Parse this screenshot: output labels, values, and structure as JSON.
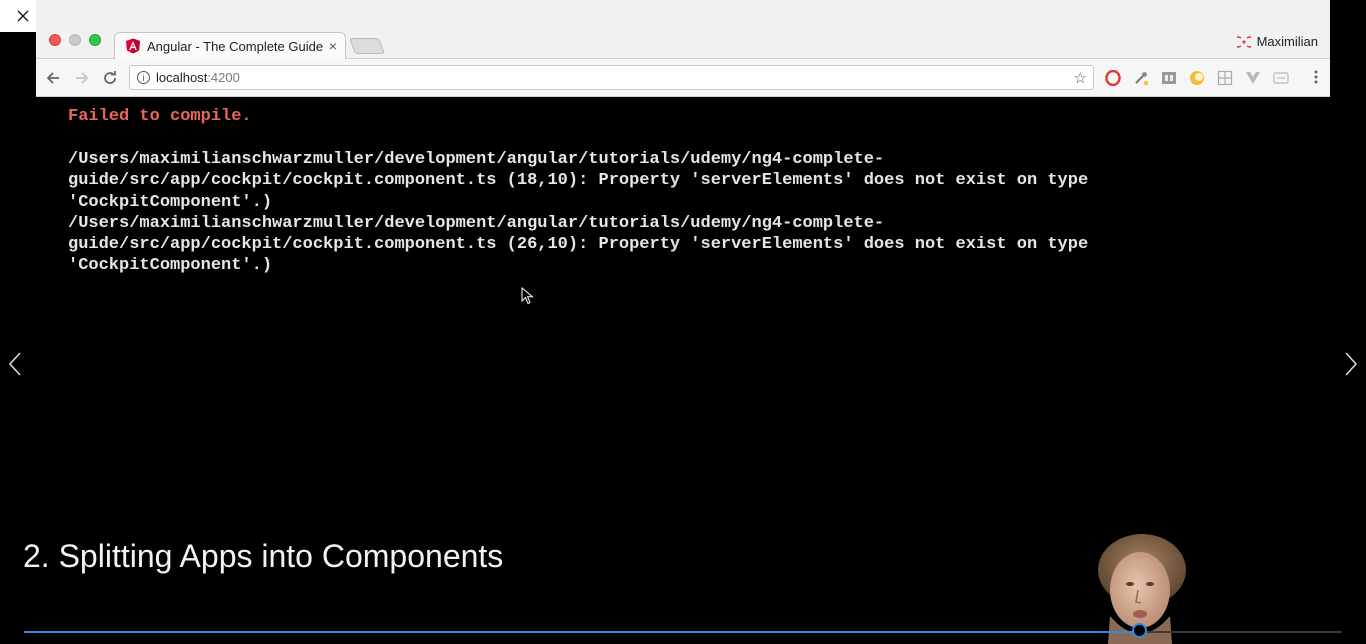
{
  "window_controls": {
    "close_icon": "close-icon",
    "restore_icon": "restore-icon",
    "minimize_icon": "minimize-icon"
  },
  "browser": {
    "tab": {
      "title": "Angular - The Complete Guide",
      "favicon": "angular-icon",
      "close": "×"
    },
    "profile": {
      "name": "Maximilian"
    },
    "address": {
      "host": "localhost",
      "port": ":4200"
    },
    "extensions": [
      "opera-icon",
      "eyedropper-icon",
      "jsonview-icon",
      "darkreader-icon",
      "grid-icon",
      "vue-icon",
      "cast-icon"
    ]
  },
  "page": {
    "error_title": "Failed to compile.",
    "error_lines": [
      "/Users/maximilianschwarzmuller/development/angular/tutorials/udemy/ng4-complete-",
      "guide/src/app/cockpit/cockpit.component.ts (18,10): Property 'serverElements' does not exist on type",
      "'CockpitComponent'.)",
      "/Users/maximilianschwarzmuller/development/angular/tutorials/udemy/ng4-complete-",
      "guide/src/app/cockpit/cockpit.component.ts (26,10): Property 'serverElements' does not exist on type",
      "'CockpitComponent'.)"
    ]
  },
  "player": {
    "lecture_title": "2. Splitting Apps into Components",
    "progress_fraction": 0.8467,
    "accent_color": "#2f8ae0"
  }
}
